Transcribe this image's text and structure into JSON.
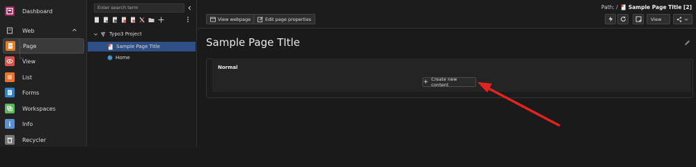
{
  "modules": [
    {
      "label": "Dashboard",
      "icon": "dashboard-icon",
      "color": "#8a2357"
    },
    {
      "label": "Web",
      "icon": "web-page-icon",
      "color": ""
    },
    {
      "label": "Page",
      "icon": "page-icon",
      "color": "#e67e22"
    },
    {
      "label": "View",
      "icon": "view-eye-icon",
      "color": "#d9534f"
    },
    {
      "label": "List",
      "icon": "list-icon",
      "color": "#e8732a"
    },
    {
      "label": "Forms",
      "icon": "forms-icon",
      "color": "#2f83c6"
    },
    {
      "label": "Workspaces",
      "icon": "workspaces-icon",
      "color": "#5cb85c"
    },
    {
      "label": "Info",
      "icon": "info-icon",
      "color": "#5a8fd0"
    },
    {
      "label": "Recycler",
      "icon": "recycler-icon",
      "color": "#777777"
    }
  ],
  "tree": {
    "search_placeholder": "Enter search term",
    "root": "Typo3 Project",
    "selected": "Sample Page TItle",
    "home": "Home"
  },
  "topbar": {
    "path_prefix": "Path: /",
    "path_title": "Sample Page TItle [2]",
    "view_webpage": "View webpage",
    "edit_properties": "Edit page properties",
    "view_dropdown": "View"
  },
  "main": {
    "title": "Sample Page TItle",
    "column_title": "Normal",
    "new_content": "Create new content"
  },
  "colors": {
    "accent_selection": "#2d4f86",
    "annotation_arrow": "#e3231d"
  }
}
